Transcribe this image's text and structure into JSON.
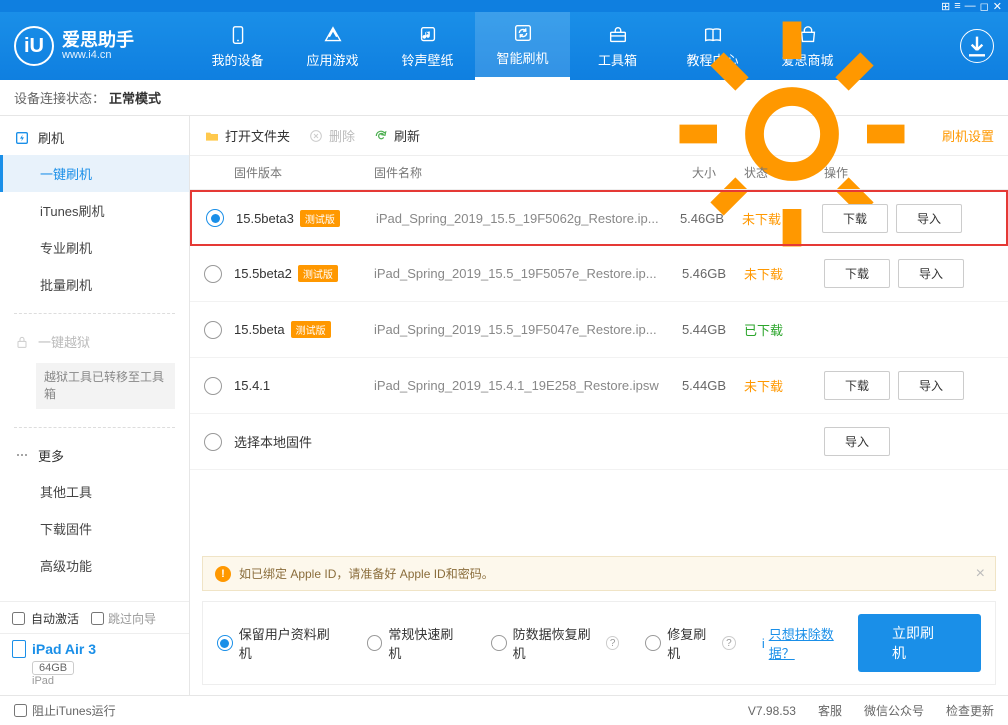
{
  "titlebar_icons": [
    "⊞",
    "≡",
    "—",
    "◻",
    "✕"
  ],
  "logo": {
    "cn": "爱思助手",
    "url": "www.i4.cn"
  },
  "nav": [
    {
      "label": "我的设备"
    },
    {
      "label": "应用游戏"
    },
    {
      "label": "铃声壁纸"
    },
    {
      "label": "智能刷机"
    },
    {
      "label": "工具箱"
    },
    {
      "label": "教程中心"
    },
    {
      "label": "爱思商城"
    }
  ],
  "status": {
    "label": "设备连接状态：",
    "mode": "正常模式"
  },
  "sidebar": {
    "flash_head": "刷机",
    "items": {
      "oneclick": "一键刷机",
      "itunes": "iTunes刷机",
      "pro": "专业刷机",
      "batch": "批量刷机"
    },
    "jailbreak_head": "一键越狱",
    "jailbreak_note": "越狱工具已转移至工具箱",
    "more_head": "更多",
    "more": {
      "other": "其他工具",
      "download": "下载固件",
      "advanced": "高级功能"
    },
    "auto_activate": "自动激活",
    "skip_guide": "跳过向导",
    "device_name": "iPad Air 3",
    "device_cap": "64GB",
    "device_type": "iPad"
  },
  "toolbar": {
    "open": "打开文件夹",
    "delete": "删除",
    "refresh": "刷新",
    "settings": "刷机设置"
  },
  "columns": {
    "version": "固件版本",
    "name": "固件名称",
    "size": "大小",
    "status": "状态",
    "ops": "操作"
  },
  "beta_badge": "测试版",
  "status_text": {
    "not_downloaded": "未下载",
    "downloaded": "已下载"
  },
  "btn_text": {
    "download": "下载",
    "import": "导入"
  },
  "rows": [
    {
      "ver": "15.5beta3",
      "beta": true,
      "name": "iPad_Spring_2019_15.5_19F5062g_Restore.ip...",
      "size": "5.46GB",
      "status": "not_downloaded",
      "selected": true,
      "highlight": true,
      "dl": true
    },
    {
      "ver": "15.5beta2",
      "beta": true,
      "name": "iPad_Spring_2019_15.5_19F5057e_Restore.ip...",
      "size": "5.46GB",
      "status": "not_downloaded",
      "dl": true
    },
    {
      "ver": "15.5beta",
      "beta": true,
      "name": "iPad_Spring_2019_15.5_19F5047e_Restore.ip...",
      "size": "5.44GB",
      "status": "downloaded",
      "dl": false
    },
    {
      "ver": "15.4.1",
      "beta": false,
      "name": "iPad_Spring_2019_15.4.1_19E258_Restore.ipsw",
      "size": "5.44GB",
      "status": "not_downloaded",
      "dl": true
    }
  ],
  "local_row": "选择本地固件",
  "notice": "如已绑定 Apple ID，请准备好 Apple ID和密码。",
  "options": {
    "keep": "保留用户资料刷机",
    "quick": "常规快速刷机",
    "anti": "防数据恢复刷机",
    "repair": "修复刷机",
    "erase": "只想抹除数据？",
    "flash": "立即刷机"
  },
  "footer": {
    "block_itunes": "阻止iTunes运行",
    "version": "V7.98.53",
    "service": "客服",
    "wechat": "微信公众号",
    "update": "检查更新"
  }
}
